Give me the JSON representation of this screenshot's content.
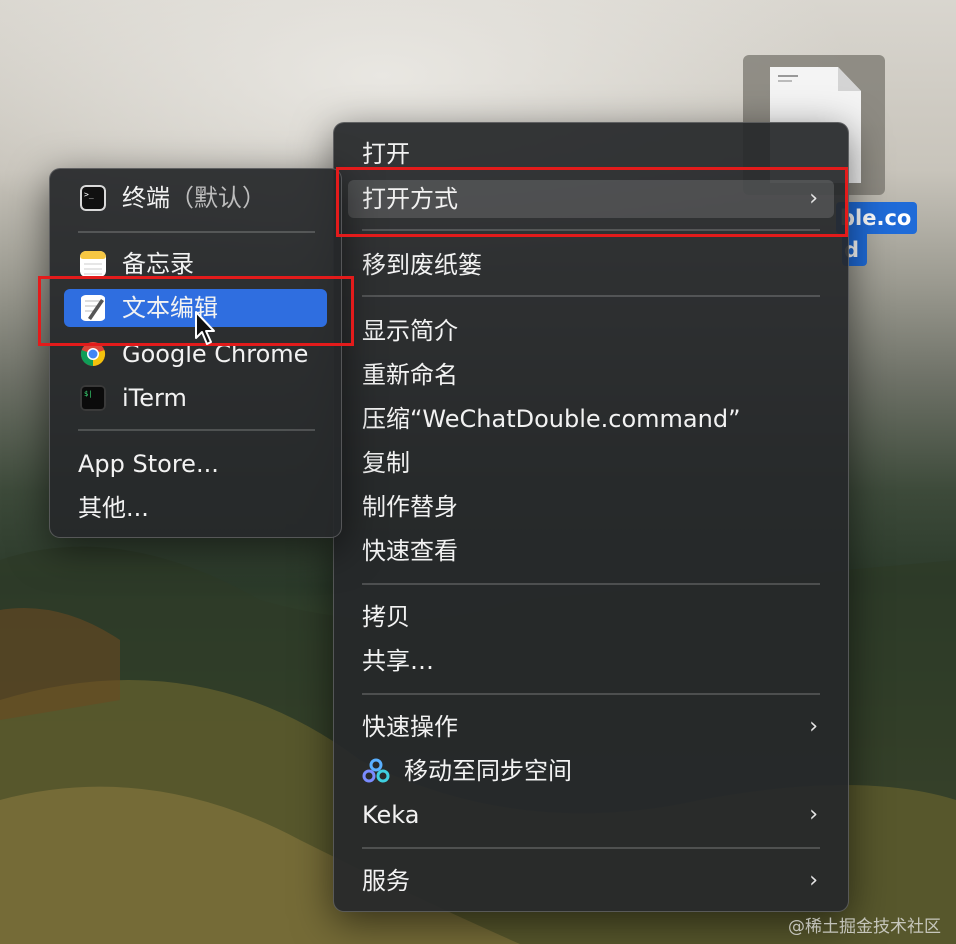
{
  "file": {
    "name_line1": "ble.co",
    "name_line2": "d"
  },
  "main_menu": {
    "items": [
      {
        "label": "打开"
      },
      {
        "label": "打开方式",
        "chevron": "›"
      },
      {
        "label": "移到废纸篓"
      },
      {
        "label": "显示简介"
      },
      {
        "label": "重新命名"
      },
      {
        "label": "压缩“WeChatDouble.command”"
      },
      {
        "label": "复制"
      },
      {
        "label": "制作替身"
      },
      {
        "label": "快速查看"
      },
      {
        "label": "拷贝"
      },
      {
        "label": "共享…"
      },
      {
        "label": "快速操作",
        "chevron": "›"
      },
      {
        "label": "移动至同步空间",
        "icon": "sync-space-icon"
      },
      {
        "label": "Keka",
        "chevron": "›"
      },
      {
        "label": "服务",
        "chevron": "›"
      }
    ]
  },
  "sub_menu": {
    "items": [
      {
        "label": "终端",
        "tag": "（默认）",
        "icon": "terminal-icon"
      },
      {
        "label": "备忘录",
        "icon": "notes-icon"
      },
      {
        "label": "文本编辑",
        "icon": "textedit-icon"
      },
      {
        "label": "Google Chrome",
        "icon": "chrome-icon"
      },
      {
        "label": "iTerm",
        "icon": "iterm-icon"
      },
      {
        "label": "App Store..."
      },
      {
        "label": "其他..."
      }
    ]
  },
  "watermark": "@稀土掘金技术社区",
  "colors": {
    "menu_bg": "#26282a",
    "highlight_blue": "#2f6ee0",
    "annotation_red": "#e31b1b",
    "file_selection": "#1f6bd8"
  }
}
